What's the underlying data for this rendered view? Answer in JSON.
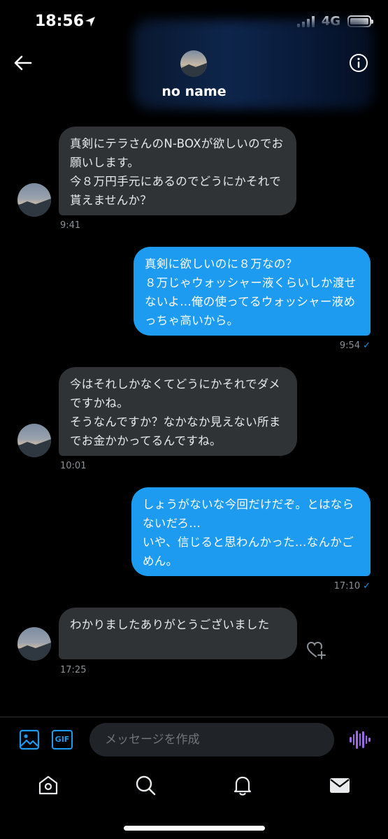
{
  "status_bar": {
    "time": "18:56",
    "network": "4G"
  },
  "header": {
    "name": "no name"
  },
  "messages": [
    {
      "direction": "in",
      "text": "真剣にテラさんのN-BOXが欲しいのでお願いします。\n今８万円手元にあるのでどうにかそれで貰えませんか？",
      "time": "9:41"
    },
    {
      "direction": "out",
      "text": "真剣に欲しいのに８万なの？\n８万じゃウォッシャー液くらいしか渡せないよ…俺の使ってるウォッシャー液めっちゃ高いから。",
      "time": "9:54"
    },
    {
      "direction": "in",
      "text": "今はそれしかなくてどうにかそれでダメですかね。\nそうなんですか？なかなか見えない所までお金かかってるんですね。",
      "time": "10:01"
    },
    {
      "direction": "out",
      "text": "しょうがないな今回だけだぞ。とはならないだろ…\nいや、信じると思わんかった…なんかごめん。",
      "time": "17:10"
    },
    {
      "direction": "in",
      "text": "わかりましたありがとうございました",
      "time": "17:25"
    }
  ],
  "compose": {
    "placeholder": "メッセージを作成",
    "gif_label": "GIF"
  },
  "icons": [
    "back-arrow-icon",
    "info-icon",
    "image-icon",
    "gif-icon",
    "voice-message-icon",
    "add-reaction-icon",
    "home-icon",
    "search-icon",
    "notifications-icon",
    "messages-icon"
  ],
  "colors": {
    "accent": "#1d9bf0",
    "incoming_bubble": "#2f3336",
    "voice": "#9e69e6"
  }
}
